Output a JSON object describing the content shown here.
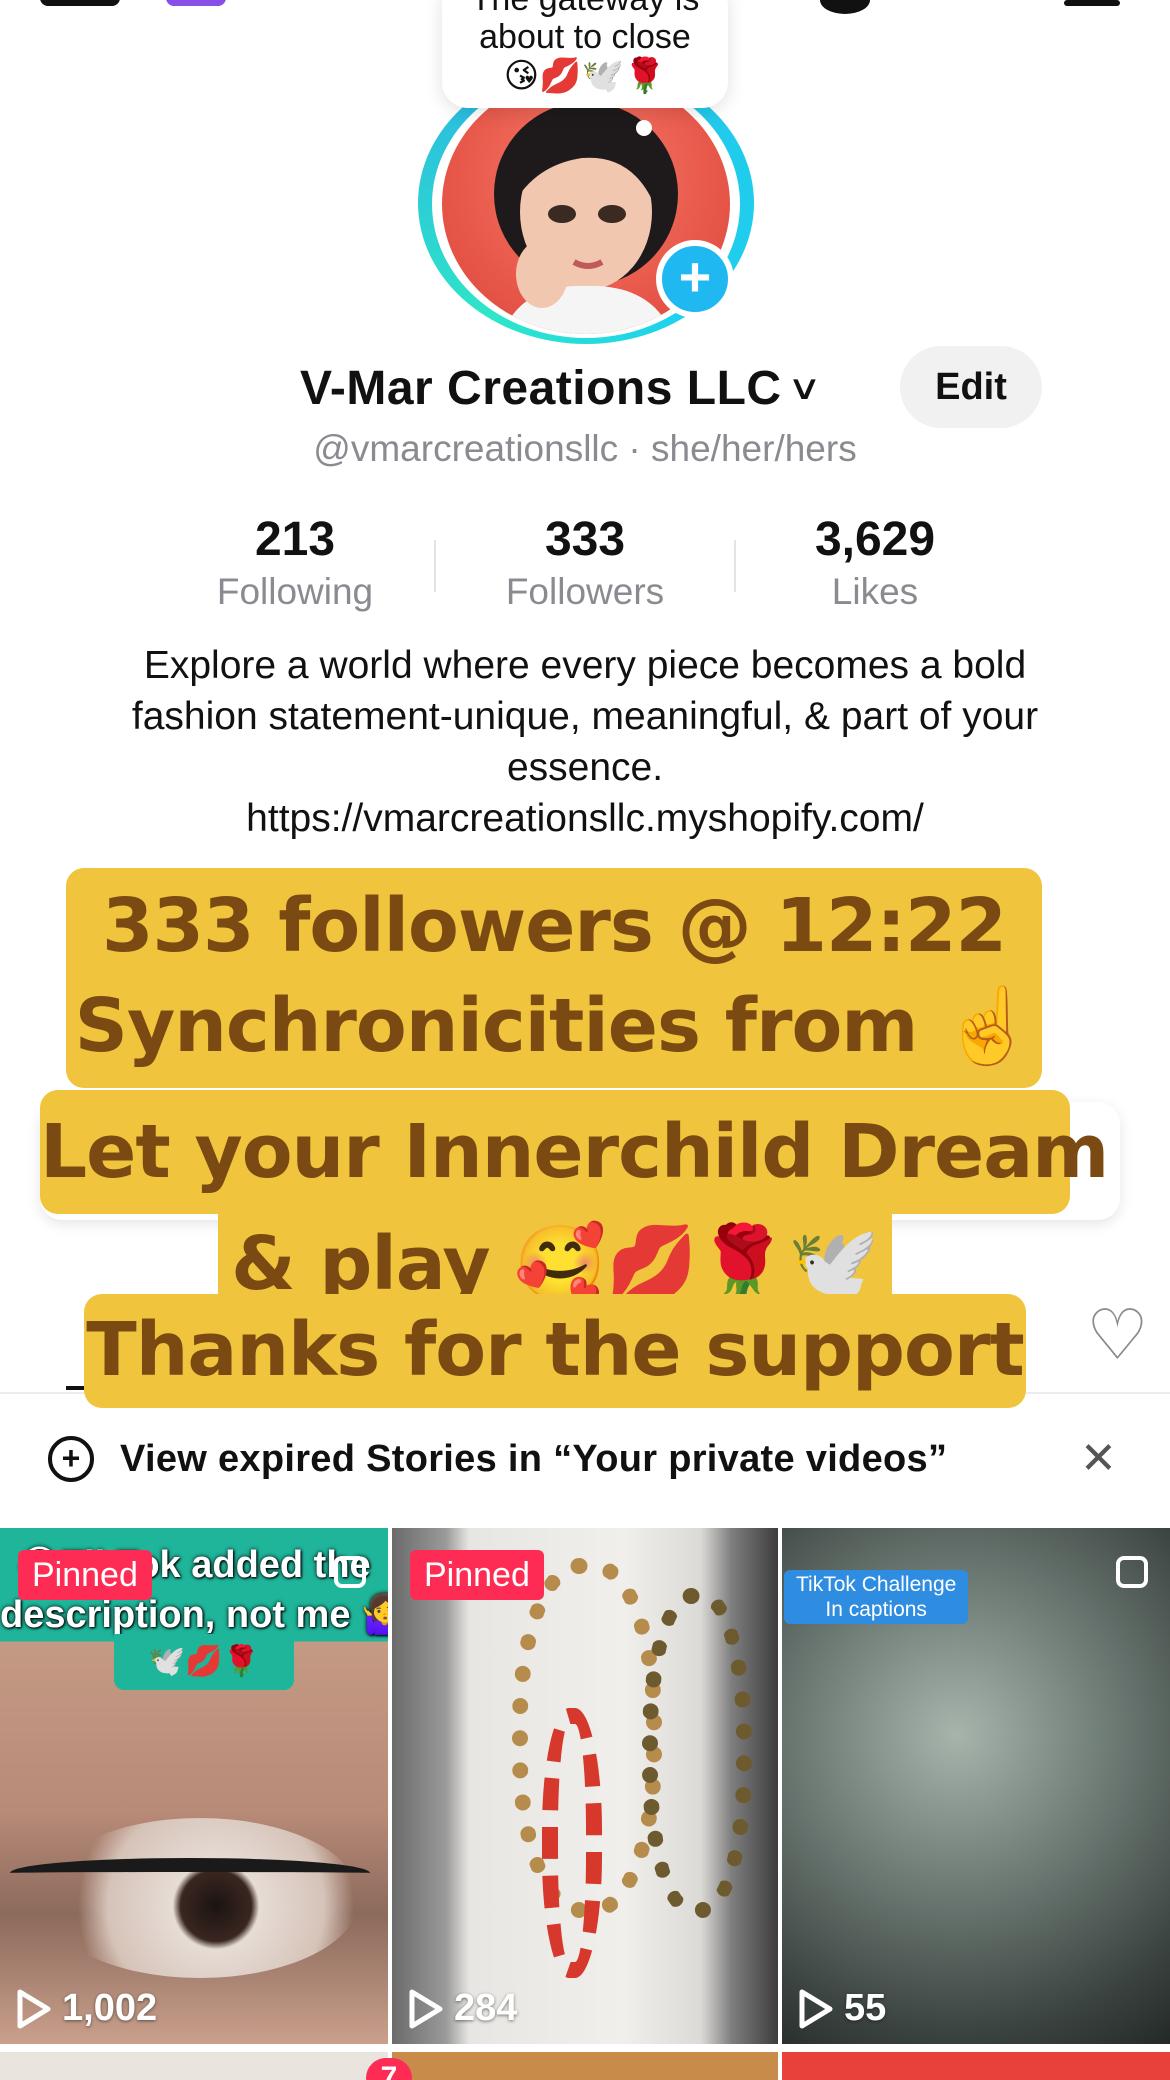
{
  "story_bubble": {
    "line1": "The gateway is",
    "line2": "about to close",
    "emojis": "😘💋🕊️🌹"
  },
  "profile": {
    "display_name": "V-Mar Creations LLC",
    "edit_label": "Edit",
    "handle_line": "@vmarcreationsllc · she/her/hers",
    "stats": [
      {
        "value": "213",
        "label": "Following"
      },
      {
        "value": "333",
        "label": "Followers"
      },
      {
        "value": "3,629",
        "label": "Likes"
      }
    ],
    "bio": "Explore a world where every piece becomes a bold fashion statement-unique, meaningful, & part of your essence.",
    "link": "https://vmarcreationsllc.myshopify.com/"
  },
  "caption": {
    "line1": "333 followers @ 12:22",
    "line2": "Synchronicities from ☝️",
    "line3": "Let your Innerchild Dream",
    "line4": "& play 🥰💋🌹🕊️",
    "line5": "Thanks for the support"
  },
  "notice": {
    "text": "View expired Stories in “Your private videos”"
  },
  "videos": [
    {
      "pinned": "Pinned",
      "overlay_line1": "😂TikTok added the",
      "overlay_line2": "description, not me 🤷‍♀️",
      "overlay_emojis": "🕊️💋🌹",
      "views": "1,002"
    },
    {
      "pinned": "Pinned",
      "views": "284"
    },
    {
      "overlay_label": "TikTok Challenge\nIn captions",
      "views": "55"
    }
  ],
  "badge_count": "7",
  "colors": {
    "accent_red": "#fe2c55",
    "caption_bg": "#f0c53d",
    "caption_text": "#7a4a12",
    "avatar_ring": "#25c5e8"
  }
}
